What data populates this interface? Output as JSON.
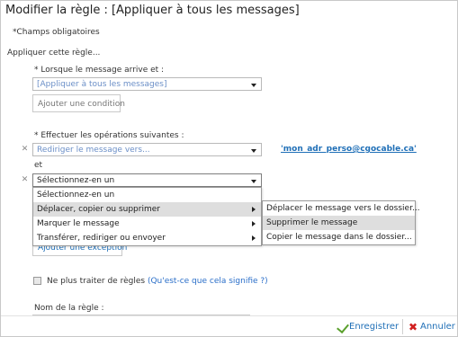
{
  "dialog": {
    "title": "Modifier la règle : [Appliquer à tous les messages]",
    "required_note": "*Champs obligatoires",
    "apply_rule": "Appliquer cette règle..."
  },
  "when": {
    "label": "* Lorsque le message arrive et :",
    "select_value": "[Appliquer à tous les messages]",
    "add_condition": "Ajouter une condition"
  },
  "actions": {
    "label": "* Effectuer les opérations suivantes :",
    "action1_value": "Rediriger le message vers...",
    "action1_link": "'mon_adr_perso@cgocable.ca'",
    "and_label": "et",
    "action2_value": "Sélectionnez-en un"
  },
  "dropdown": {
    "items": [
      "Sélectionnez-en un",
      "Déplacer, copier ou supprimer",
      "Marquer le message",
      "Transférer, rediriger ou envoyer"
    ]
  },
  "submenu": {
    "items": [
      "Déplacer le message vers le dossier...",
      "Supprimer le message",
      "Copier le message dans le dossier..."
    ]
  },
  "exception": {
    "add_exception": "Ajouter une exception"
  },
  "stop": {
    "label": "Ne plus traiter de règles",
    "help": "(Qu'est-ce que cela signifie ?)"
  },
  "rule_name": {
    "label": "Nom de la règle :"
  },
  "footer": {
    "save": "Enregistrer",
    "cancel": "Annuler"
  }
}
